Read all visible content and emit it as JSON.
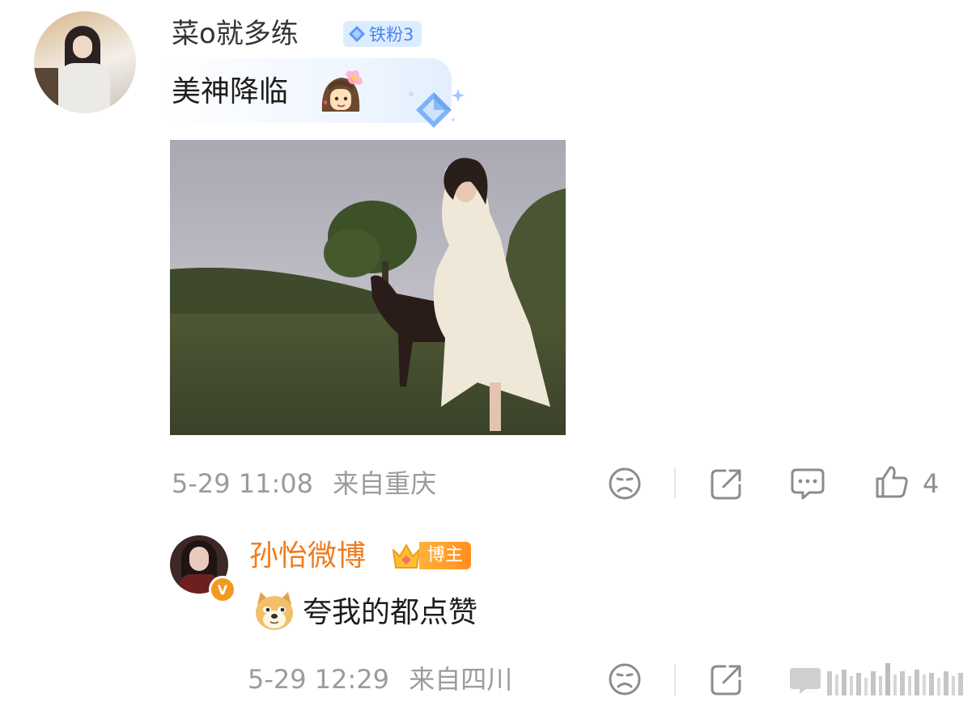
{
  "comment": {
    "author": "菜o就多练",
    "fan_badge": "铁粉3",
    "text": "美神降临",
    "inline_emoji": "girl-with-flower-emoji",
    "image": "woman-in-white-dress-with-horse-photo",
    "date": "5-29 11:08",
    "location": "来自重庆",
    "likes": "4"
  },
  "reply": {
    "author": "孙怡微博",
    "verified": "V",
    "role_badge": "博主",
    "emoji": "doge-emoji",
    "text": "夸我的都点赞",
    "date": "5-29 12:29",
    "location": "来自四川"
  },
  "icons": [
    "sad-face-icon",
    "share-icon",
    "comment-icon",
    "thumbs-up-icon",
    "diamond-icon",
    "crown-icon",
    "verified-v-icon"
  ],
  "colors": {
    "username_reply": "#f07c1d",
    "badge_blue": "#4b84e8",
    "badge_blue_bg": "#dcecff",
    "meta_gray": "#9b9b9b",
    "blogger_orange": "#ff9a26"
  }
}
